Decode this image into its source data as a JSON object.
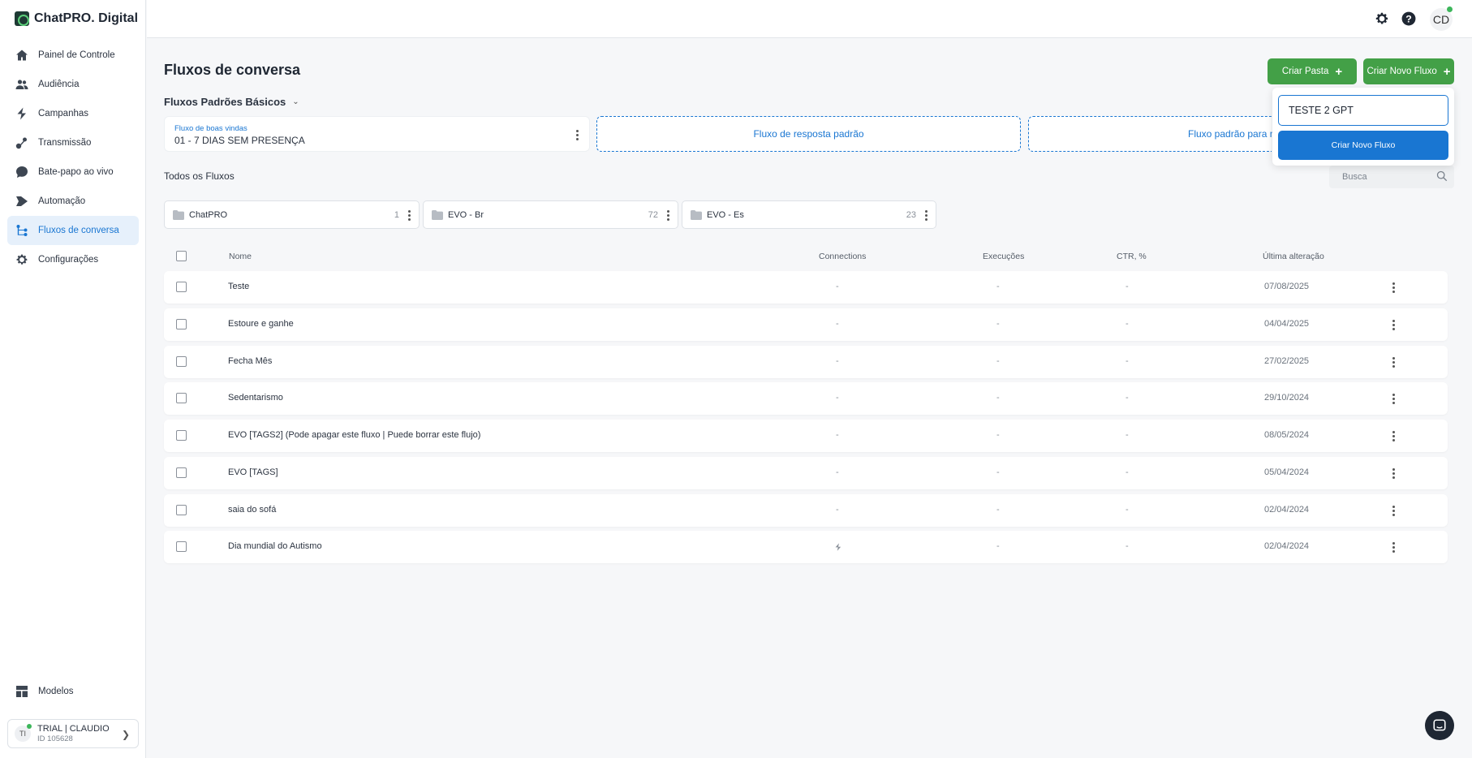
{
  "brand": {
    "name": "ChatPRO. Digital"
  },
  "sidebar": {
    "items": [
      {
        "label": "Painel de Controle",
        "icon": "home-icon"
      },
      {
        "label": "Audiência",
        "icon": "users-icon"
      },
      {
        "label": "Campanhas",
        "icon": "bolt-icon"
      },
      {
        "label": "Transmissão",
        "icon": "broadcast-icon"
      },
      {
        "label": "Bate-papo ao vivo",
        "icon": "chat-icon"
      },
      {
        "label": "Automação",
        "icon": "automation-icon"
      },
      {
        "label": "Fluxos de conversa",
        "icon": "flow-icon",
        "active": true
      },
      {
        "label": "Configurações",
        "icon": "gear-icon"
      }
    ],
    "bottom_item": {
      "label": "Modelos",
      "icon": "templates-icon"
    },
    "account": {
      "initials": "TI",
      "name": "TRIAL | CLAUDIO",
      "id": "ID 105628"
    }
  },
  "topbar": {
    "avatar_initials": "CD"
  },
  "main": {
    "title": "Fluxos de conversa",
    "btn_create_folder": "Criar Pasta",
    "btn_create_flow": "Criar Novo Fluxo",
    "section_label": "Fluxos Padrões Básicos",
    "default_flows": {
      "welcome_label": "Fluxo de boas vindas",
      "welcome_value": "01 - 7 DIAS SEM PRESENÇA",
      "default_reply": "Fluxo de resposta padrão",
      "default_other": "Fluxo padrão para m"
    },
    "all_flows_label": "Todos os Fluxos",
    "search_placeholder": "Busca",
    "folders": [
      {
        "name": "ChatPRO",
        "count": "1"
      },
      {
        "name": "EVO - Br",
        "count": "72"
      },
      {
        "name": "EVO - Es",
        "count": "23"
      }
    ],
    "table": {
      "headers": {
        "name": "Nome",
        "connections": "Connections",
        "executions": "Execuções",
        "ctr": "CTR, %",
        "last_change": "Última alteração"
      },
      "rows": [
        {
          "name": "Teste",
          "connections": "-",
          "executions": "-",
          "ctr": "-",
          "date": "07/08/2025"
        },
        {
          "name": "Estoure e ganhe",
          "connections": "-",
          "executions": "-",
          "ctr": "-",
          "date": "04/04/2025"
        },
        {
          "name": "Fecha Mês",
          "connections": "-",
          "executions": "-",
          "ctr": "-",
          "date": "27/02/2025"
        },
        {
          "name": "Sedentarismo",
          "connections": "-",
          "executions": "-",
          "ctr": "-",
          "date": "29/10/2024"
        },
        {
          "name": "EVO [TAGS2] (Pode apagar este fluxo | Puede borrar este flujo)",
          "connections": "-",
          "executions": "-",
          "ctr": "-",
          "date": "08/05/2024"
        },
        {
          "name": "EVO [TAGS]",
          "connections": "-",
          "executions": "-",
          "ctr": "-",
          "date": "05/04/2024"
        },
        {
          "name": "saia do sofá",
          "connections": "-",
          "executions": "-",
          "ctr": "-",
          "date": "02/04/2024"
        },
        {
          "name": "Dia mundial do Autismo",
          "connections": "bolt-icon",
          "executions": "-",
          "ctr": "-",
          "date": "02/04/2024"
        }
      ]
    }
  },
  "popover": {
    "input_value": "TESTE 2 GPT",
    "button_label": "Criar Novo Fluxo"
  },
  "colors": {
    "accent": "#1976d2",
    "green": "#43a047",
    "active_bg": "#e6f0fb"
  }
}
